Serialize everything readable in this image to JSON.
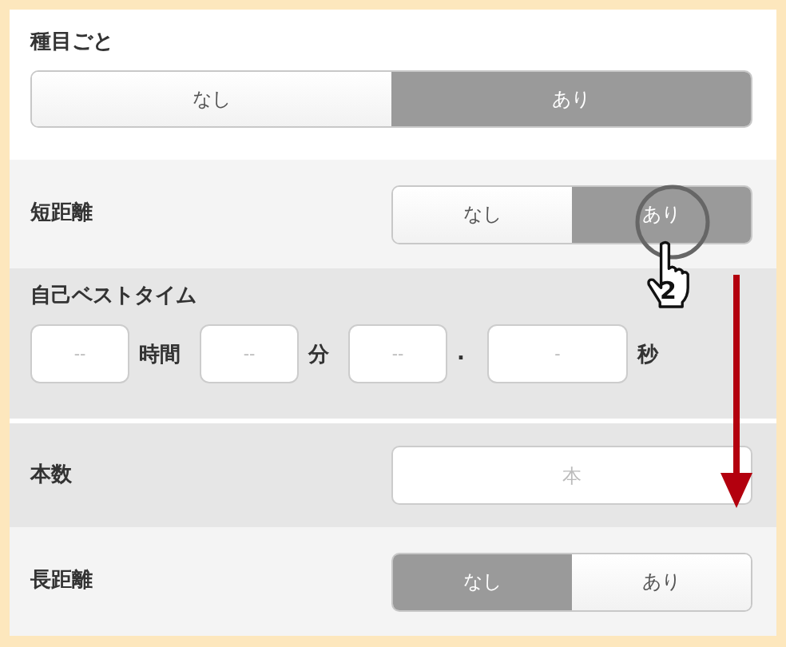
{
  "sections": [
    {
      "kind": "wide_toggle",
      "label": "種目ごと",
      "options": [
        {
          "label": "なし",
          "selected": false
        },
        {
          "label": "あり",
          "selected": true
        }
      ]
    },
    {
      "kind": "toggle",
      "label": "短距離",
      "options": [
        {
          "label": "なし",
          "selected": false
        },
        {
          "label": "あり",
          "selected": true
        }
      ]
    },
    {
      "kind": "time",
      "label": "自己ベストタイム",
      "fields": [
        {
          "placeholder": "--",
          "unit": "時間"
        },
        {
          "placeholder": "--",
          "unit": "分"
        },
        {
          "placeholder": "--",
          "unit": "."
        },
        {
          "placeholder": "-",
          "unit": "秒"
        }
      ]
    },
    {
      "kind": "number",
      "label": "本数",
      "placeholder": "本"
    },
    {
      "kind": "toggle",
      "label": "長距離",
      "options": [
        {
          "label": "なし",
          "selected": true
        },
        {
          "label": "あり",
          "selected": false
        }
      ]
    }
  ],
  "annotation": {
    "step": "2"
  }
}
